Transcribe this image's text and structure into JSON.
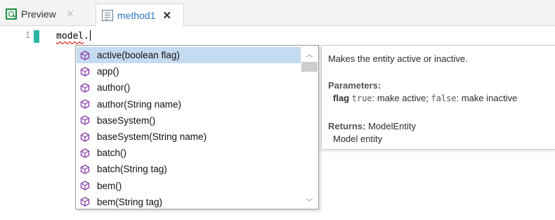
{
  "tabs": [
    {
      "label": "Preview",
      "icon": "preview-icon",
      "active": false
    },
    {
      "label": "method1",
      "icon": "method-file-icon",
      "active": true
    }
  ],
  "editor": {
    "line_number": "1",
    "code_object": "model",
    "code_rest": "."
  },
  "completion": {
    "selected_index": 0,
    "item_icon": "cube-icon",
    "icon_color": "#8b3fa8",
    "items": [
      "active(boolean flag)",
      "app()",
      "author()",
      "author(String name)",
      "baseSystem()",
      "baseSystem(String name)",
      "batch()",
      "batch(String tag)",
      "bem()",
      "bem(String tag)"
    ]
  },
  "doc": {
    "summary": "Makes the entity active or inactive.",
    "parameters_heading": "Parameters:",
    "param_name": "flag",
    "param_true_code": "true",
    "param_true_text": ": make active; ",
    "param_false_code": "false",
    "param_false_text": ": make inactive",
    "returns_heading": "Returns:",
    "returns_type": "ModelEntity",
    "returns_desc": "Model entity"
  },
  "colors": {
    "accent": "#2a78c5",
    "selection": "#c5dbf1",
    "change_bar": "#2bb5a3",
    "squiggle": "#e0342c"
  }
}
